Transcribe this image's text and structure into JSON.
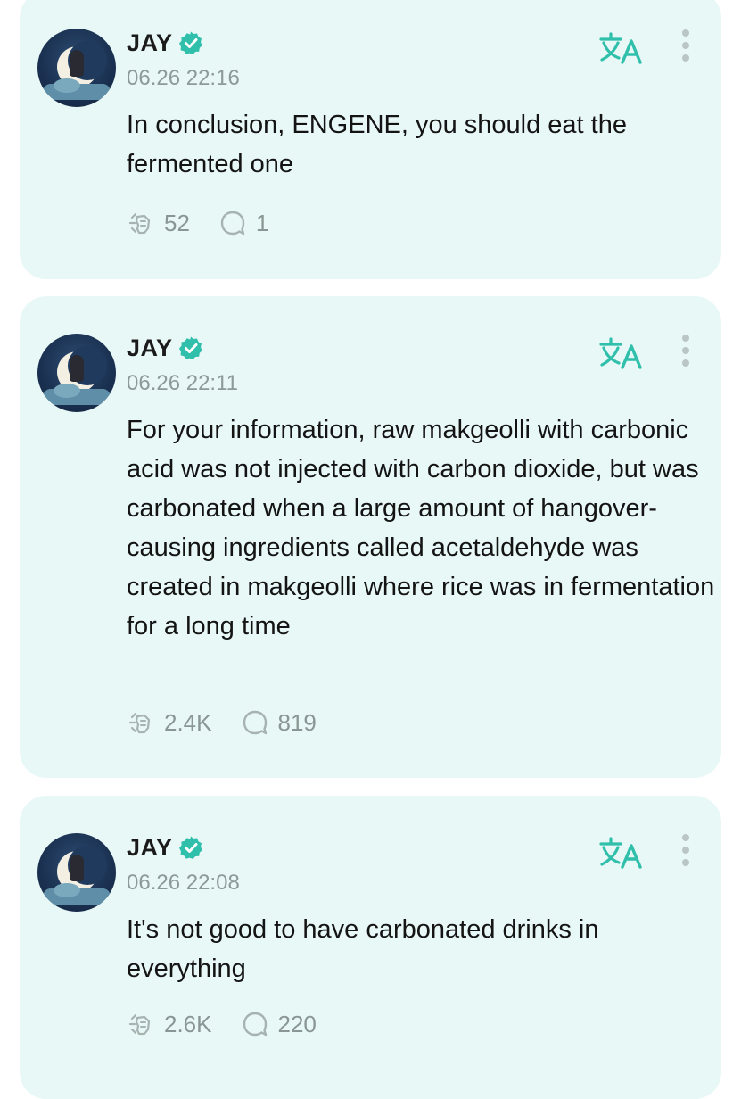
{
  "colors": {
    "card_background": "#e8f8f6",
    "accent": "#2fbfab",
    "text": "#141414",
    "muted": "#8a9694"
  },
  "posts": [
    {
      "author": "JAY",
      "verified_icon": "verified-badge-icon",
      "timestamp": "06.26 22:16",
      "text": "In conclusion, ENGENE, you should eat the fermented one",
      "likes": "52",
      "comments": "1"
    },
    {
      "author": "JAY",
      "verified_icon": "verified-badge-icon",
      "timestamp": "06.26 22:11",
      "text": "For your information, raw makgeolli with carbonic acid was not injected with carbon dioxide, but was carbonated when a large amount of hangover-causing ingredients called acetaldehyde was created in makgeolli where rice was in fermentation for a long time",
      "likes": "2.4K",
      "comments": "819"
    },
    {
      "author": "JAY",
      "verified_icon": "verified-badge-icon",
      "timestamp": "06.26 22:08",
      "text": "It's not good to have carbonated drinks in everything",
      "likes": "2.6K",
      "comments": "220"
    }
  ]
}
